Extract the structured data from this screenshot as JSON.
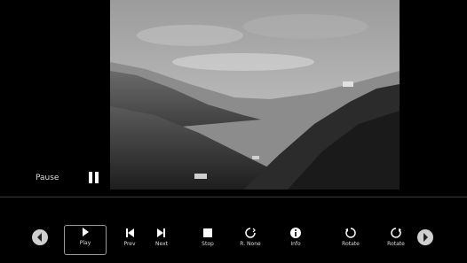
{
  "player": {
    "status_text": "Pause"
  },
  "controls": {
    "buttons": [
      {
        "label": "Play",
        "icon": "play-icon"
      },
      {
        "label": "Prev",
        "icon": "skip-previous-icon"
      },
      {
        "label": "Next",
        "icon": "skip-next-icon"
      },
      {
        "label": "Stop",
        "icon": "stop-icon"
      },
      {
        "label": "R. None",
        "icon": "repeat-icon"
      },
      {
        "label": "Info",
        "icon": "info-icon"
      },
      {
        "label": "Rotate",
        "icon": "rotate-left-icon"
      },
      {
        "label": "Rotate",
        "icon": "rotate-right-icon"
      }
    ],
    "selected_label": "Play"
  },
  "colors": {
    "background": "#000000",
    "text": "#dddddd",
    "nav_arrow": "#cfcfcf"
  }
}
